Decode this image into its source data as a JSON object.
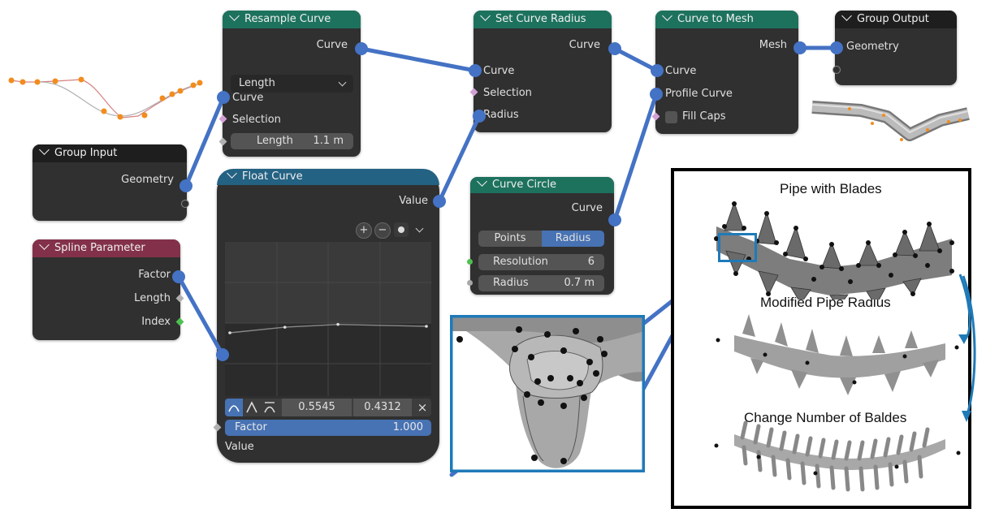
{
  "nodes": {
    "resample": {
      "title": "Resample Curve",
      "out_curve": "Curve",
      "mode": "Length",
      "in_curve": "Curve",
      "in_selection": "Selection",
      "length_label": "Length",
      "length_value": "1.1 m"
    },
    "set_radius": {
      "title": "Set Curve Radius",
      "out_curve": "Curve",
      "in_curve": "Curve",
      "in_selection": "Selection",
      "in_radius": "Radius"
    },
    "curve_to_mesh": {
      "title": "Curve to Mesh",
      "out_mesh": "Mesh",
      "in_curve": "Curve",
      "in_profile": "Profile Curve",
      "fill_caps": "Fill Caps"
    },
    "group_output": {
      "title": "Group Output",
      "in_geometry": "Geometry"
    },
    "group_input": {
      "title": "Group Input",
      "out_geometry": "Geometry"
    },
    "spline_param": {
      "title": "Spline Parameter",
      "out_factor": "Factor",
      "out_length": "Length",
      "out_index": "Index"
    },
    "float_curve": {
      "title": "Float Curve",
      "out_value": "Value",
      "x_value": "0.5545",
      "y_value": "0.4312",
      "close": "×",
      "factor_label": "Factor",
      "factor_value": "1.000",
      "in_value": "Value",
      "zoom_in": "+",
      "zoom_out": "−"
    },
    "curve_circle": {
      "title": "Curve Circle",
      "out_curve": "Curve",
      "mode_points": "Points",
      "mode_radius": "Radius",
      "resolution_label": "Resolution",
      "resolution_value": "6",
      "radius_label": "Radius",
      "radius_value": "0.7 m"
    }
  },
  "captions": {
    "pipe": "Pipe with Blades",
    "modified": "Modified Pipe Radius",
    "change": "Change Number of Baldes"
  },
  "colors": {
    "geometry_socket": "#00d6a3",
    "link": "#4472c4",
    "highlight_box": "#1f7ab8",
    "curve_points": "#f28c1c",
    "factor_bar": "#4772b3"
  },
  "float_curve_points": [
    0.0,
    0.28,
    0.55,
    1.0
  ]
}
